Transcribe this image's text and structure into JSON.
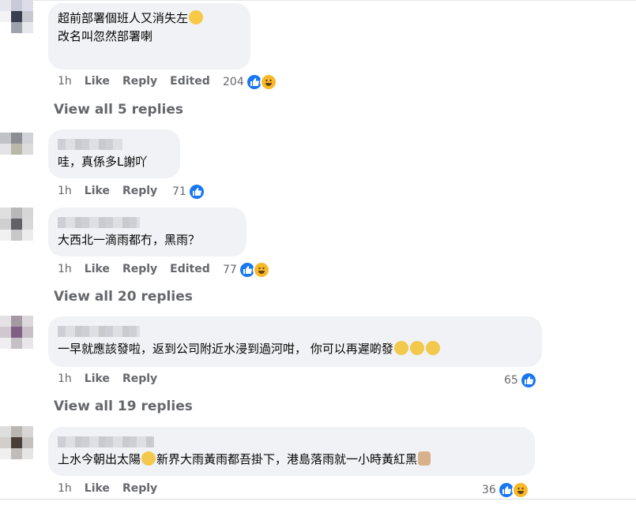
{
  "comments": [
    {
      "avatar_colors": [
        "#e6e6ef",
        "#c9cad9",
        "#dcdde8",
        "#f3f3f6",
        "#3a3f4f",
        "#c8c9d0",
        "#ffffff",
        "#9ea2ad",
        "#e7e8ec"
      ],
      "lines": [
        "超前部署個班人又消失左",
        "改名叫忽然部署喇"
      ],
      "line_emoji": [
        [
          "laugh-emoji"
        ],
        []
      ],
      "time": "1h",
      "like": "Like",
      "reply": "Reply",
      "edited": "Edited",
      "count": "204",
      "reactions": [
        "like",
        "haha"
      ],
      "view_replies": "View all 5 replies"
    },
    {
      "avatar_colors": [
        "#c0c2c8",
        "#8b8d95",
        "#d0d2d7",
        "#e4e4e8",
        "#b9b7a8",
        "#dcdcdc",
        "#ffffff",
        "#ffffff",
        "#ffffff"
      ],
      "lines": [
        "哇，真係多L謝吖"
      ],
      "time": "1h",
      "like": "Like",
      "reply": "Reply",
      "count": "71",
      "reactions": [
        "like"
      ]
    },
    {
      "avatar_colors": [
        "#dfdfdf",
        "#b8b8b8",
        "#d6d6d6",
        "#cfcfcf",
        "#5f6164",
        "#d8d8d8",
        "#f1f1f1",
        "#c7c7c7",
        "#ececec"
      ],
      "lines": [
        "大西北一滴雨都冇，黑雨？"
      ],
      "time": "1h",
      "like": "Like",
      "reply": "Reply",
      "edited": "Edited",
      "count": "77",
      "reactions": [
        "like",
        "haha"
      ],
      "view_replies": "View all 20 replies"
    },
    {
      "avatar_colors": [
        "#e3e1e4",
        "#a59aa4",
        "#dcd8dc",
        "#d1c7cf",
        "#7f5f83",
        "#c9bfc6",
        "#efeef0",
        "#c5c0c5",
        "#e8e6e8"
      ],
      "lines": [
        "一早就應該發啦，返到公司附近水浸到過河咁，  你可以再遲啲發"
      ],
      "line_emoji": [
        [
          "eyeroll-emoji",
          "eyeroll-emoji",
          "eyeroll-emoji"
        ]
      ],
      "time": "1h",
      "like": "Like",
      "reply": "Reply",
      "count": "65",
      "reactions": [
        "like"
      ],
      "view_replies": "View all 19 replies"
    },
    {
      "avatar_colors": [
        "#dedede",
        "#b9b6b2",
        "#d9d7d5",
        "#d1cecb",
        "#4a3f38",
        "#c4c0bd",
        "#efefef",
        "#bfbcb9",
        "#e5e5e5"
      ],
      "lines": [
        "上水今朝出太陽",
        "新界大雨黃雨都吾掛下，港島落雨就一小時黃紅黑"
      ],
      "time": "1h",
      "like": "Like",
      "reply": "Reply",
      "count": "36",
      "reactions": [
        "like",
        "haha"
      ]
    }
  ],
  "colors": {
    "like_blue": "#1877f2",
    "haha_yellow": "#f7b928",
    "bubble": "#f0f2f5",
    "meta_grey": "#65676b"
  }
}
